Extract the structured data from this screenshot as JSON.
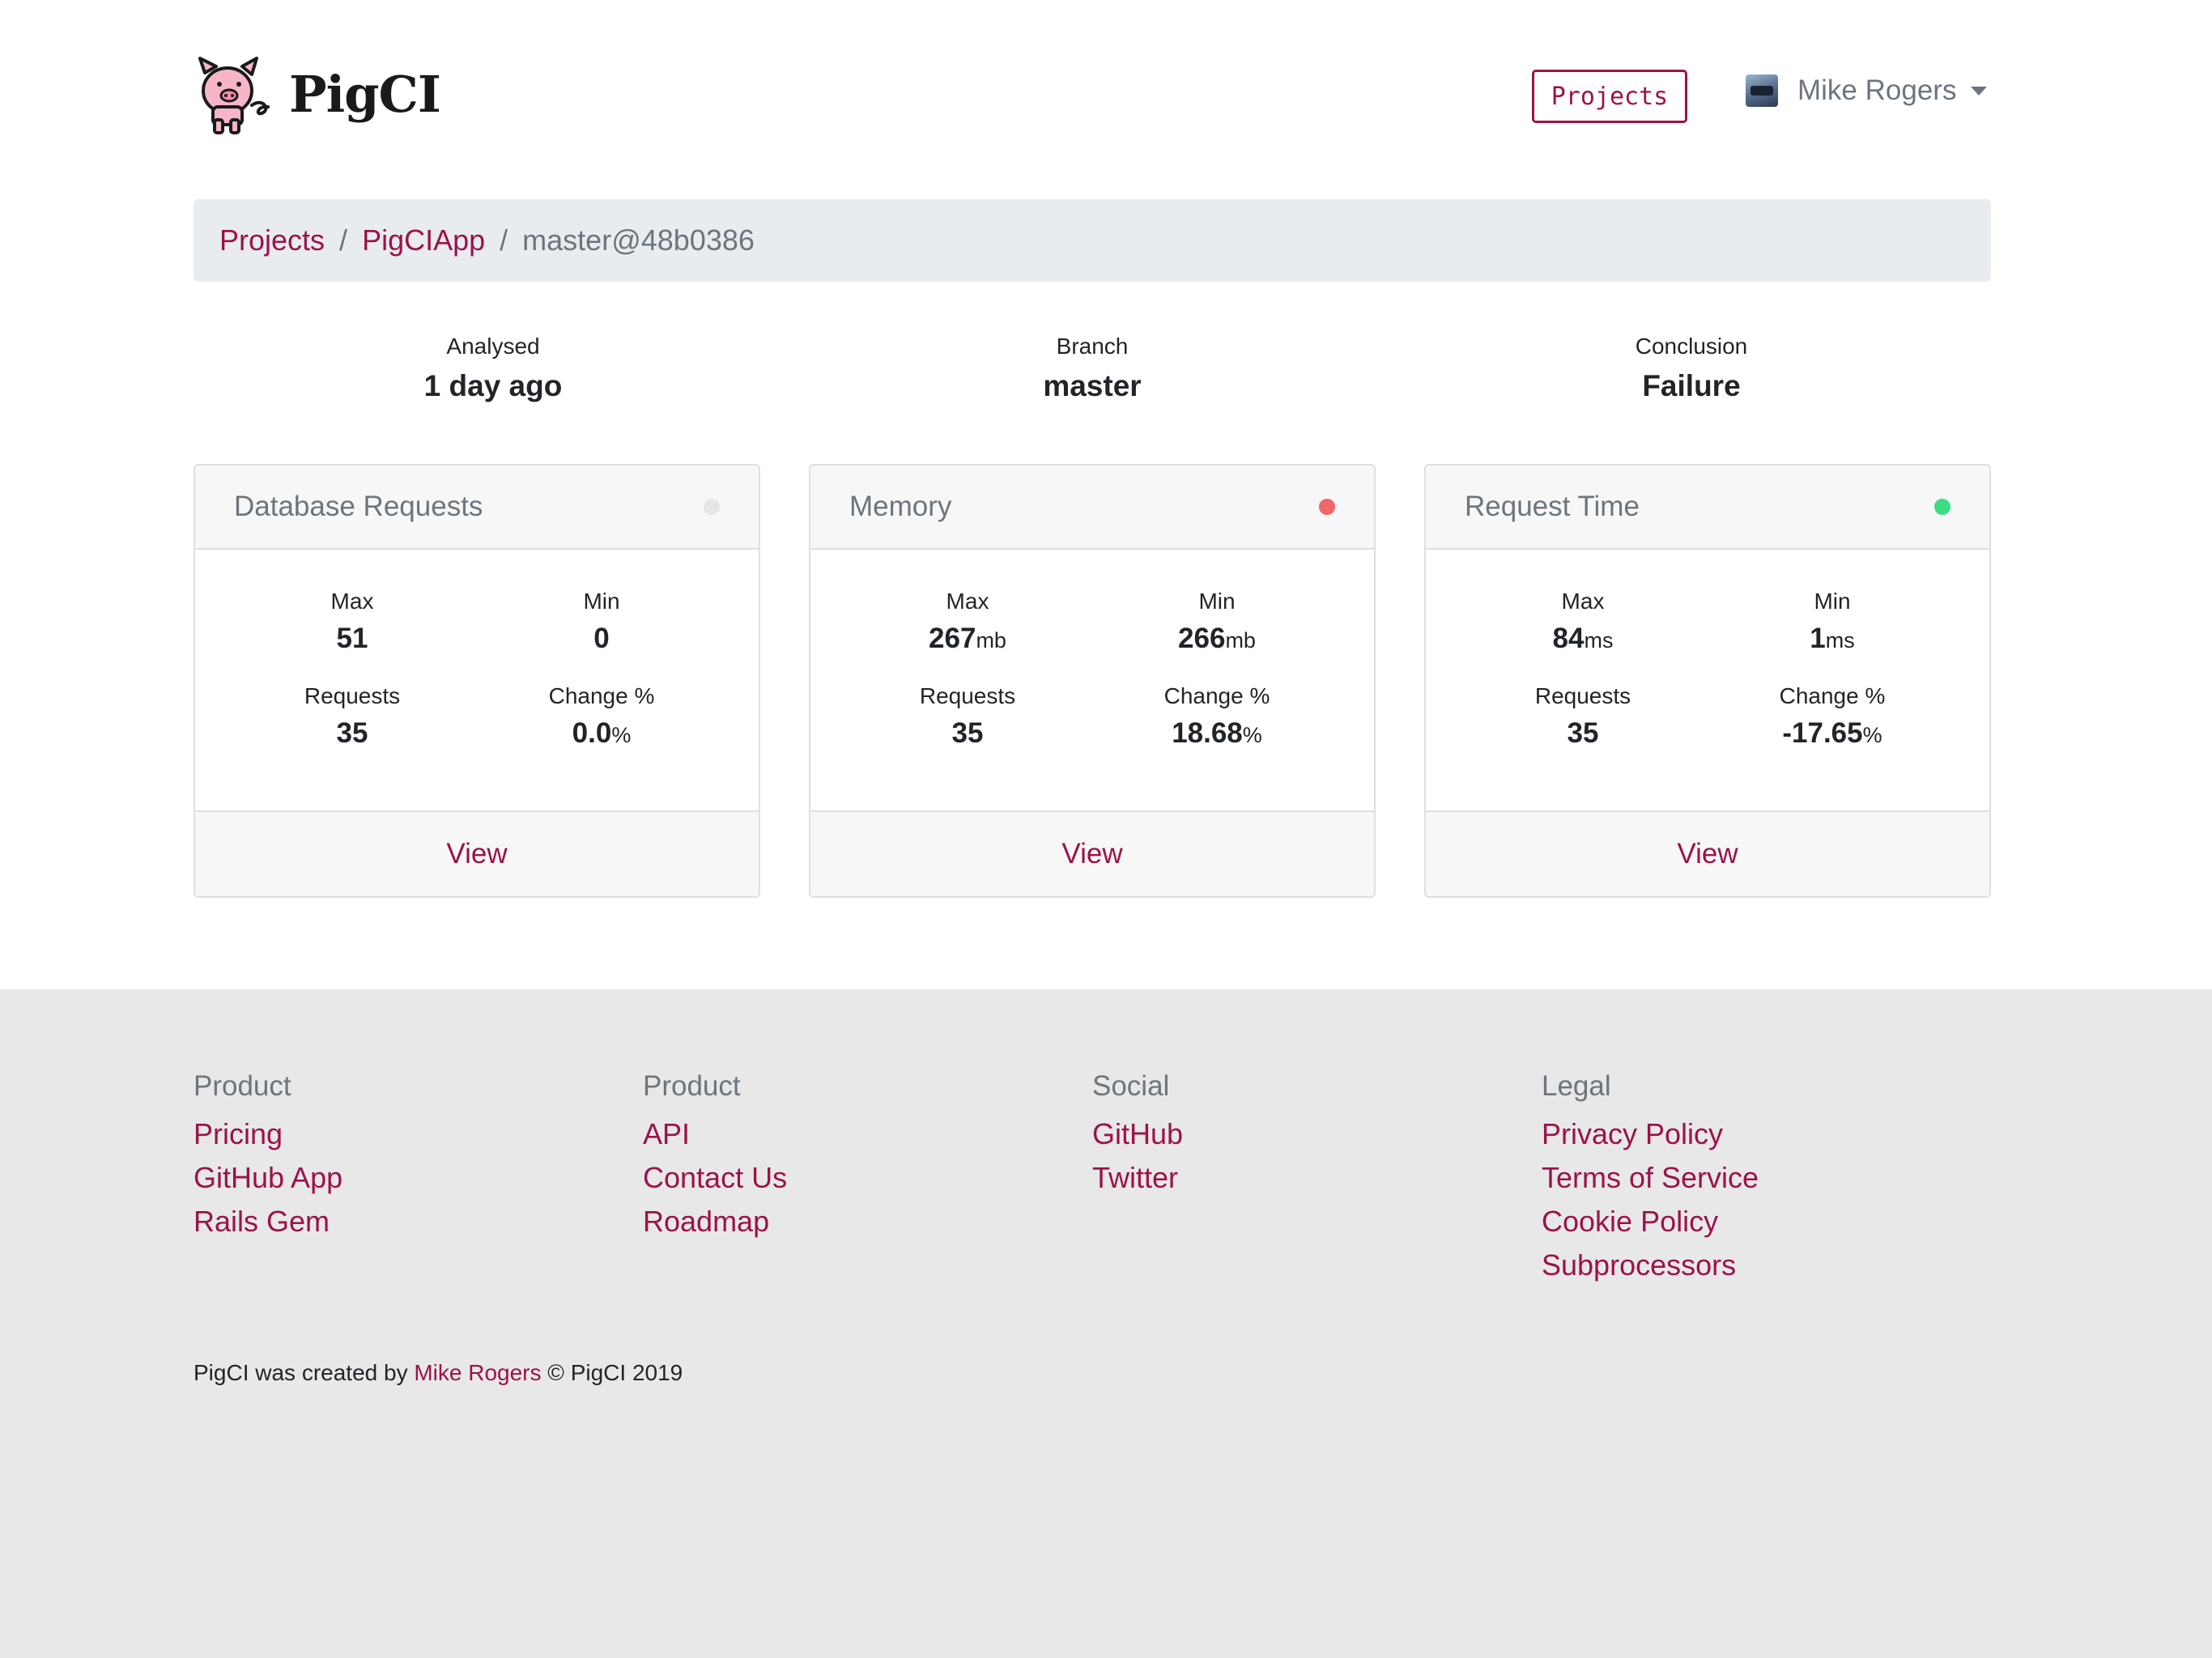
{
  "header": {
    "brand": "PigCI",
    "projects_button": "Projects",
    "user_name": "Mike Rogers"
  },
  "breadcrumb": {
    "items": [
      "Projects",
      "PigCIApp"
    ],
    "current": "master@48b0386",
    "separator": "/"
  },
  "summary": [
    {
      "label": "Analysed",
      "value": "1 day ago"
    },
    {
      "label": "Branch",
      "value": "master"
    },
    {
      "label": "Conclusion",
      "value": "Failure"
    }
  ],
  "cards": [
    {
      "title": "Database Requests",
      "status_color": "#e6e6e6",
      "max": {
        "label": "Max",
        "value": "51",
        "unit": ""
      },
      "min": {
        "label": "Min",
        "value": "0",
        "unit": ""
      },
      "requests": {
        "label": "Requests",
        "value": "35",
        "unit": ""
      },
      "change": {
        "label": "Change %",
        "value": "0.0",
        "unit": "%"
      },
      "view": "View"
    },
    {
      "title": "Memory",
      "status_color": "#f06565",
      "max": {
        "label": "Max",
        "value": "267",
        "unit": "mb"
      },
      "min": {
        "label": "Min",
        "value": "266",
        "unit": "mb"
      },
      "requests": {
        "label": "Requests",
        "value": "35",
        "unit": ""
      },
      "change": {
        "label": "Change %",
        "value": "18.68",
        "unit": "%"
      },
      "view": "View"
    },
    {
      "title": "Request Time",
      "status_color": "#3ddc84",
      "max": {
        "label": "Max",
        "value": "84",
        "unit": "ms"
      },
      "min": {
        "label": "Min",
        "value": "1",
        "unit": "ms"
      },
      "requests": {
        "label": "Requests",
        "value": "35",
        "unit": ""
      },
      "change": {
        "label": "Change %",
        "value": "-17.65",
        "unit": "%"
      },
      "view": "View"
    }
  ],
  "footer": {
    "columns": [
      {
        "heading": "Product",
        "links": [
          "Pricing",
          "GitHub App",
          "Rails Gem"
        ]
      },
      {
        "heading": "Product",
        "links": [
          "API",
          "Contact Us",
          "Roadmap"
        ]
      },
      {
        "heading": "Social",
        "links": [
          "GitHub",
          "Twitter"
        ]
      },
      {
        "heading": "Legal",
        "links": [
          "Privacy Policy",
          "Terms of Service",
          "Cookie Policy",
          "Subprocessors"
        ]
      }
    ],
    "copyright_prefix": "PigCI was created by ",
    "copyright_link": "Mike Rogers",
    "copyright_suffix": " © PigCI 2019"
  },
  "colors": {
    "accent": "#9b1349",
    "muted": "#6c757d",
    "breadcrumb_bg": "#e9ecef",
    "footer_bg": "#e8e8e8"
  }
}
